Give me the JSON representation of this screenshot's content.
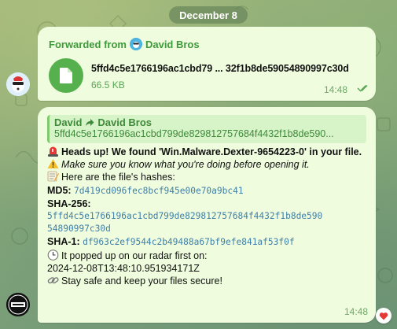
{
  "date_separator": "December 8",
  "file_message": {
    "forwarded_label": "Forwarded from",
    "forwarded_from": "David Bros",
    "file_name": "5ffd4c5e1766196ac1cbd79 ... 32f1b8de59054890997c30d",
    "file_size": "66.5 KB",
    "time": "14:48",
    "status": "read"
  },
  "report_message": {
    "reply_sender": "David",
    "reply_forwarded_from": "David Bros",
    "reply_preview": "5ffd4c5e1766196ac1cbd799de829812757684f4432f1b8de590...",
    "alert_line": "Heads up! We found 'Win.Malware.Dexter-9654223-0' in your file.",
    "warning_line": "Make sure you know what you're doing before opening it.",
    "hashes_intro": "Here are the file's hashes:",
    "md5_label": "MD5:",
    "md5_value": "7d419cd096fec8bcf945e00e70a9bc41",
    "sha256_label": "SHA-256:",
    "sha256_value_line1": "5ffd4c5e1766196ac1cbd799de829812757684f4432f1b8de590",
    "sha256_value_line2": "54890997c30d",
    "sha1_label": "SHA-1:",
    "sha1_value": "df963c2ef9544c2b49488a67bf9efe841af53f0f",
    "first_seen_intro": "It popped up on our radar first on:",
    "first_seen_value": "2024-12-08T13:48:10.951934171Z",
    "closing_line": "Stay safe and keep your files secure!",
    "time": "14:48",
    "reaction": "heart"
  },
  "colors": {
    "bubble": "#effdde",
    "accent_green": "#3e9a3a",
    "link_blue": "#3e7fa8"
  },
  "icons": [
    "file-icon",
    "double-check-icon",
    "forward-arrow-icon",
    "siren-icon",
    "warning-icon",
    "memo-icon",
    "clock-icon",
    "link-icon",
    "heart-icon"
  ]
}
